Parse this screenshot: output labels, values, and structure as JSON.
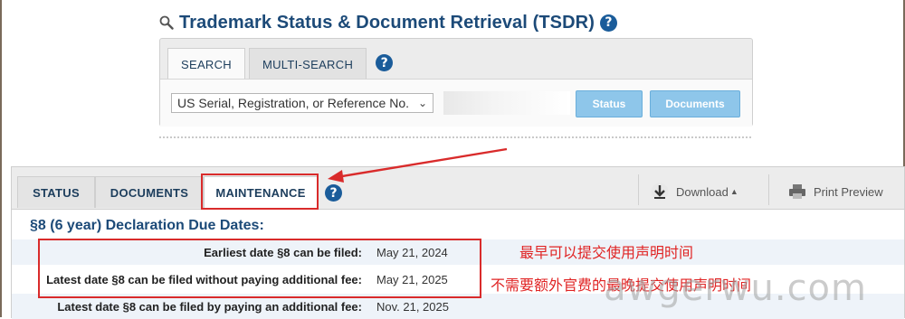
{
  "app": {
    "title": "Trademark Status & Document Retrieval (TSDR)",
    "help_glyph": "?"
  },
  "search": {
    "tabs": [
      {
        "label": "SEARCH",
        "active": true
      },
      {
        "label": "MULTI-SEARCH",
        "active": false
      }
    ],
    "type_select": "US Serial, Registration, or Reference No.",
    "serial_value": "",
    "status_button": "Status",
    "documents_button": "Documents"
  },
  "record": {
    "tabs": [
      {
        "label": "STATUS",
        "active": false
      },
      {
        "label": "DOCUMENTS",
        "active": false
      },
      {
        "label": "MAINTENANCE",
        "active": true
      }
    ],
    "download_label": "Download",
    "print_label": "Print Preview",
    "section_title": "§8 (6 year) Declaration Due Dates:",
    "rows": [
      {
        "label": "Earliest date §8 can be filed:",
        "value": "May 21, 2024"
      },
      {
        "label": "Latest date §8 can be filed without paying additional fee:",
        "value": "May 21, 2025"
      },
      {
        "label": "Latest date §8 can be filed by paying an additional fee:",
        "value": "Nov. 21, 2025"
      }
    ]
  },
  "annotations": {
    "earliest_note": "最早可以提交使用声明时间",
    "latest_note": "不需要额外官费的最晚提交使用声明时间",
    "color": "#e02424"
  },
  "watermark": "awgerwu.com",
  "colors": {
    "title_blue": "#1c4a78",
    "button_blue": "#8ec6ea",
    "highlight_red": "#d92b2b"
  }
}
